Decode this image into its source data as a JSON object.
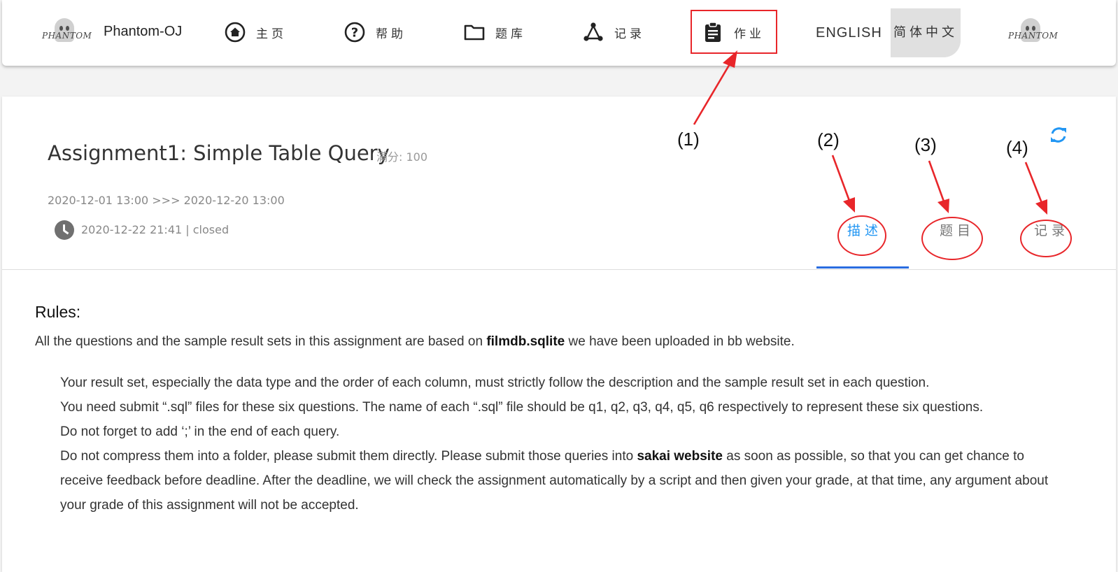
{
  "nav": {
    "brand": "Phantom-OJ",
    "logo_text": "PHANTOM",
    "items": [
      {
        "label": "主页",
        "icon": "home-icon"
      },
      {
        "label": "帮助",
        "icon": "help-icon"
      },
      {
        "label": "题库",
        "icon": "folder-icon"
      },
      {
        "label": "记录",
        "icon": "network-icon"
      },
      {
        "label": "作业",
        "icon": "clipboard-icon"
      }
    ],
    "lang_en": "ENGLISH",
    "lang_zh": "简体中文"
  },
  "annotations": {
    "n1": "(1)",
    "n2": "(2)",
    "n3": "(3)",
    "n4": "(4)"
  },
  "assignment": {
    "title": "Assignment1: Simple Table Query",
    "score": "满分: 100",
    "dates": "2020-12-01 13:00 >>> 2020-12-20 13:00",
    "status": "2020-12-22 21:41 | closed"
  },
  "tabs": {
    "description": "描述",
    "problems": "题目",
    "records": "记录"
  },
  "rules": {
    "heading": "Rules:",
    "intro_before": "All the questions and the sample result sets in this assignment are based on ",
    "intro_bold": "filmdb.sqlite",
    "intro_after": " we have been uploaded in bb website.",
    "line1": "Your result set, especially the data type and the order of each column, must strictly follow the description and the sample result set in each question.",
    "line2": "You need submit “.sql” files for these six questions. The name of each “.sql” file should be q1, q2, q3, q4, q5, q6 respectively to represent these six questions.",
    "line3": "Do not forget to add ‘;’ in the end of each query.",
    "line4_before": "Do not compress them into a folder, please submit them directly. Please submit those queries into ",
    "line4_bold": "sakai website",
    "line4_after": " as soon as possible, so that you can get chance to receive feedback before deadline. After the deadline, we will check the assignment automatically by a script and then given your grade, at that time, any argument about your grade of this assignment will not be accepted."
  },
  "colors": {
    "accent": "#2196f3",
    "annotation": "#e8262a"
  }
}
